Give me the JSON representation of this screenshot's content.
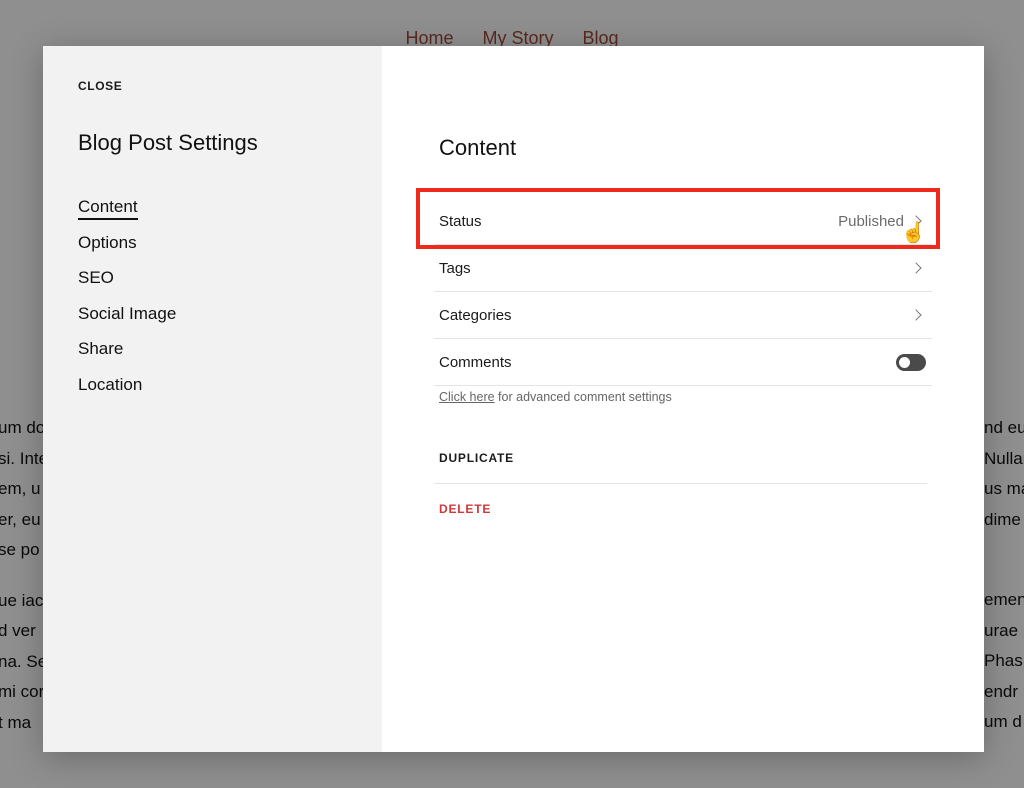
{
  "background": {
    "nav": [
      "Home",
      "My Story",
      "Blog"
    ],
    "left_fragments": [
      "um do",
      "si. Inte",
      "em, u",
      "er, eu",
      "se po",
      "",
      "ue iac",
      "d ver",
      "na. Se",
      "mi cor",
      "t ma"
    ],
    "right_fragments": [
      "nd eu",
      "Nullar",
      "us ma",
      "dime",
      "",
      "",
      "emen",
      "urae",
      "Phas",
      "endr",
      "um d"
    ]
  },
  "modal": {
    "close_label": "CLOSE",
    "title": "Blog Post Settings",
    "nav": [
      {
        "label": "Content",
        "active": true
      },
      {
        "label": "Options",
        "active": false
      },
      {
        "label": "SEO",
        "active": false
      },
      {
        "label": "Social Image",
        "active": false
      },
      {
        "label": "Share",
        "active": false
      },
      {
        "label": "Location",
        "active": false
      }
    ],
    "content": {
      "title": "Content",
      "rows": [
        {
          "label": "Status",
          "value": "Published"
        },
        {
          "label": "Tags",
          "value": ""
        },
        {
          "label": "Categories",
          "value": ""
        },
        {
          "label": "Comments",
          "toggle": false
        }
      ],
      "advanced_link": "Click here",
      "advanced_text": " for advanced comment settings",
      "duplicate_label": "DUPLICATE",
      "delete_label": "DELETE"
    }
  },
  "colors": {
    "highlight": "#ee2a1d",
    "delete": "#cc3a3a",
    "nav_link": "#a04a3a"
  }
}
